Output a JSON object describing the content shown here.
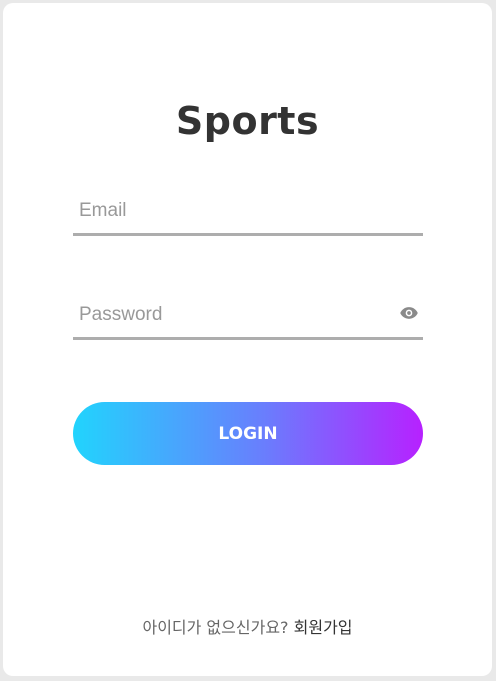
{
  "app": {
    "title": "Sports"
  },
  "form": {
    "email_placeholder": "Email",
    "email_value": "",
    "password_placeholder": "Password",
    "password_value": "",
    "password_toggle_icon": "eye-icon",
    "login_label": "LOGIN"
  },
  "footer": {
    "prompt_text": "아이디가 없으신가요?",
    "signup_link": "회원가입"
  },
  "colors": {
    "gradient_start": "#21d4fd",
    "gradient_end": "#b721ff",
    "underline": "#adadad",
    "title": "#333333"
  }
}
